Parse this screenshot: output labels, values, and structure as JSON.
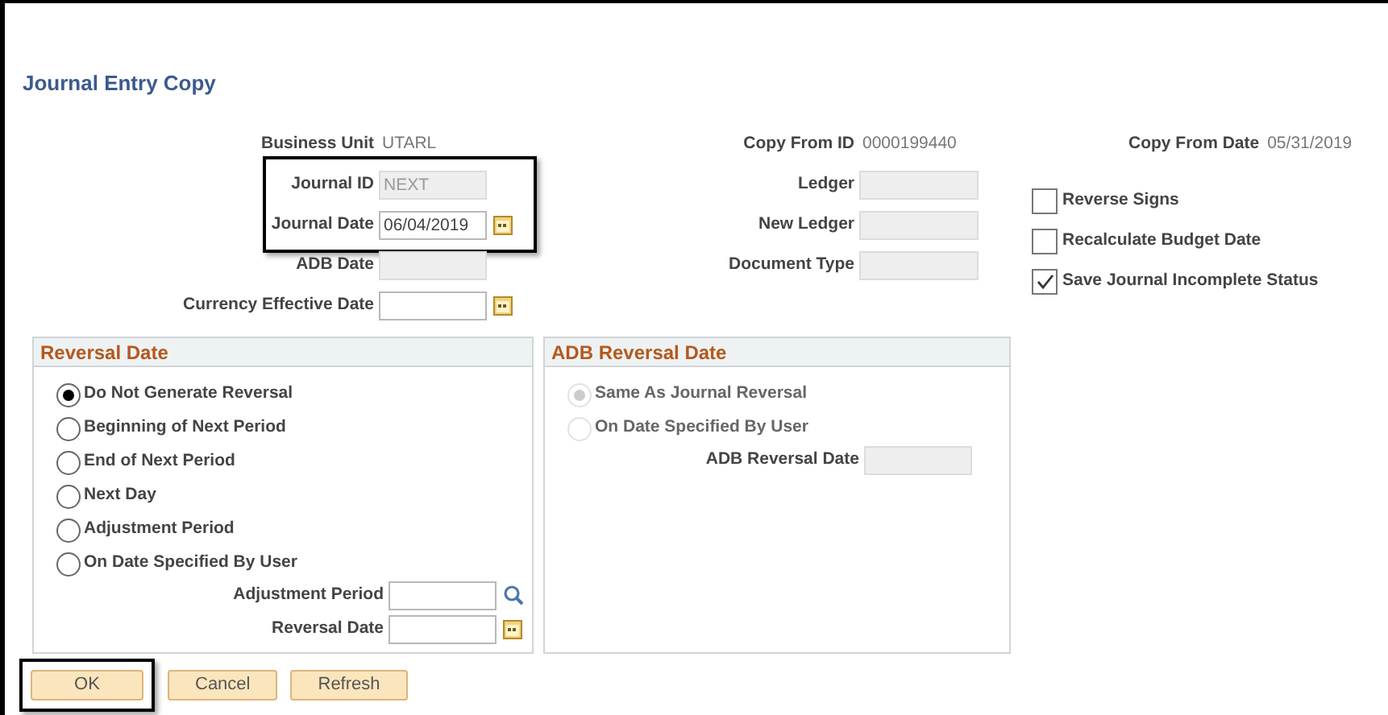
{
  "page_title": "Journal Entry Copy",
  "left_fields": [
    {
      "label": "Business Unit",
      "kind": "display",
      "value": "UTARL",
      "highlighted": false
    },
    {
      "label": "Journal ID",
      "kind": "input",
      "value": "NEXT",
      "disabled": true,
      "highlighted": true
    },
    {
      "label": "Journal Date",
      "kind": "date",
      "value": "06/04/2019",
      "disabled": false,
      "highlighted": true
    },
    {
      "label": "ADB Date",
      "kind": "input",
      "disabled": true,
      "highlighted": false
    },
    {
      "label": "Currency Effective Date",
      "kind": "date",
      "disabled": false,
      "highlighted": false
    }
  ],
  "middle_fields": [
    {
      "label": "Copy From ID",
      "kind": "display",
      "value": "0000199440"
    },
    {
      "label": "Ledger",
      "kind": "input",
      "disabled": true
    },
    {
      "label": "New Ledger",
      "kind": "input",
      "disabled": true
    },
    {
      "label": "Document Type",
      "kind": "input",
      "disabled": true
    }
  ],
  "copy_from_date": {
    "label": "Copy From Date",
    "value": "05/31/2019"
  },
  "checkboxes": [
    {
      "label": "Reverse Signs",
      "checked": false
    },
    {
      "label": "Recalculate Budget Date",
      "checked": false
    },
    {
      "label": "Save Journal Incomplete Status",
      "checked": true
    }
  ],
  "reversal_date": {
    "title": "Reversal Date",
    "options": [
      {
        "label": "Do Not Generate Reversal",
        "selected": true,
        "disabled": false
      },
      {
        "label": "Beginning of Next Period",
        "selected": false,
        "disabled": false
      },
      {
        "label": "End of Next Period",
        "selected": false,
        "disabled": false
      },
      {
        "label": "Next Day",
        "selected": false,
        "disabled": false
      },
      {
        "label": "Adjustment Period",
        "selected": false,
        "disabled": false
      },
      {
        "label": "On Date Specified By User",
        "selected": false,
        "disabled": false
      }
    ],
    "fields": [
      {
        "label": "Adjustment Period",
        "kind": "lookup",
        "disabled": false
      },
      {
        "label": "Reversal Date",
        "kind": "date",
        "disabled": false
      }
    ]
  },
  "adb_reversal_date": {
    "title": "ADB Reversal Date",
    "options": [
      {
        "label": "Same As Journal Reversal",
        "selected": true,
        "disabled": true
      },
      {
        "label": "On Date Specified By User",
        "selected": false,
        "disabled": true
      }
    ],
    "fields": [
      {
        "label": "ADB Reversal Date",
        "kind": "input",
        "disabled": true
      }
    ]
  },
  "buttons": [
    {
      "label": "OK",
      "highlighted": true
    },
    {
      "label": "Cancel",
      "highlighted": false
    },
    {
      "label": "Refresh",
      "highlighted": false
    }
  ]
}
